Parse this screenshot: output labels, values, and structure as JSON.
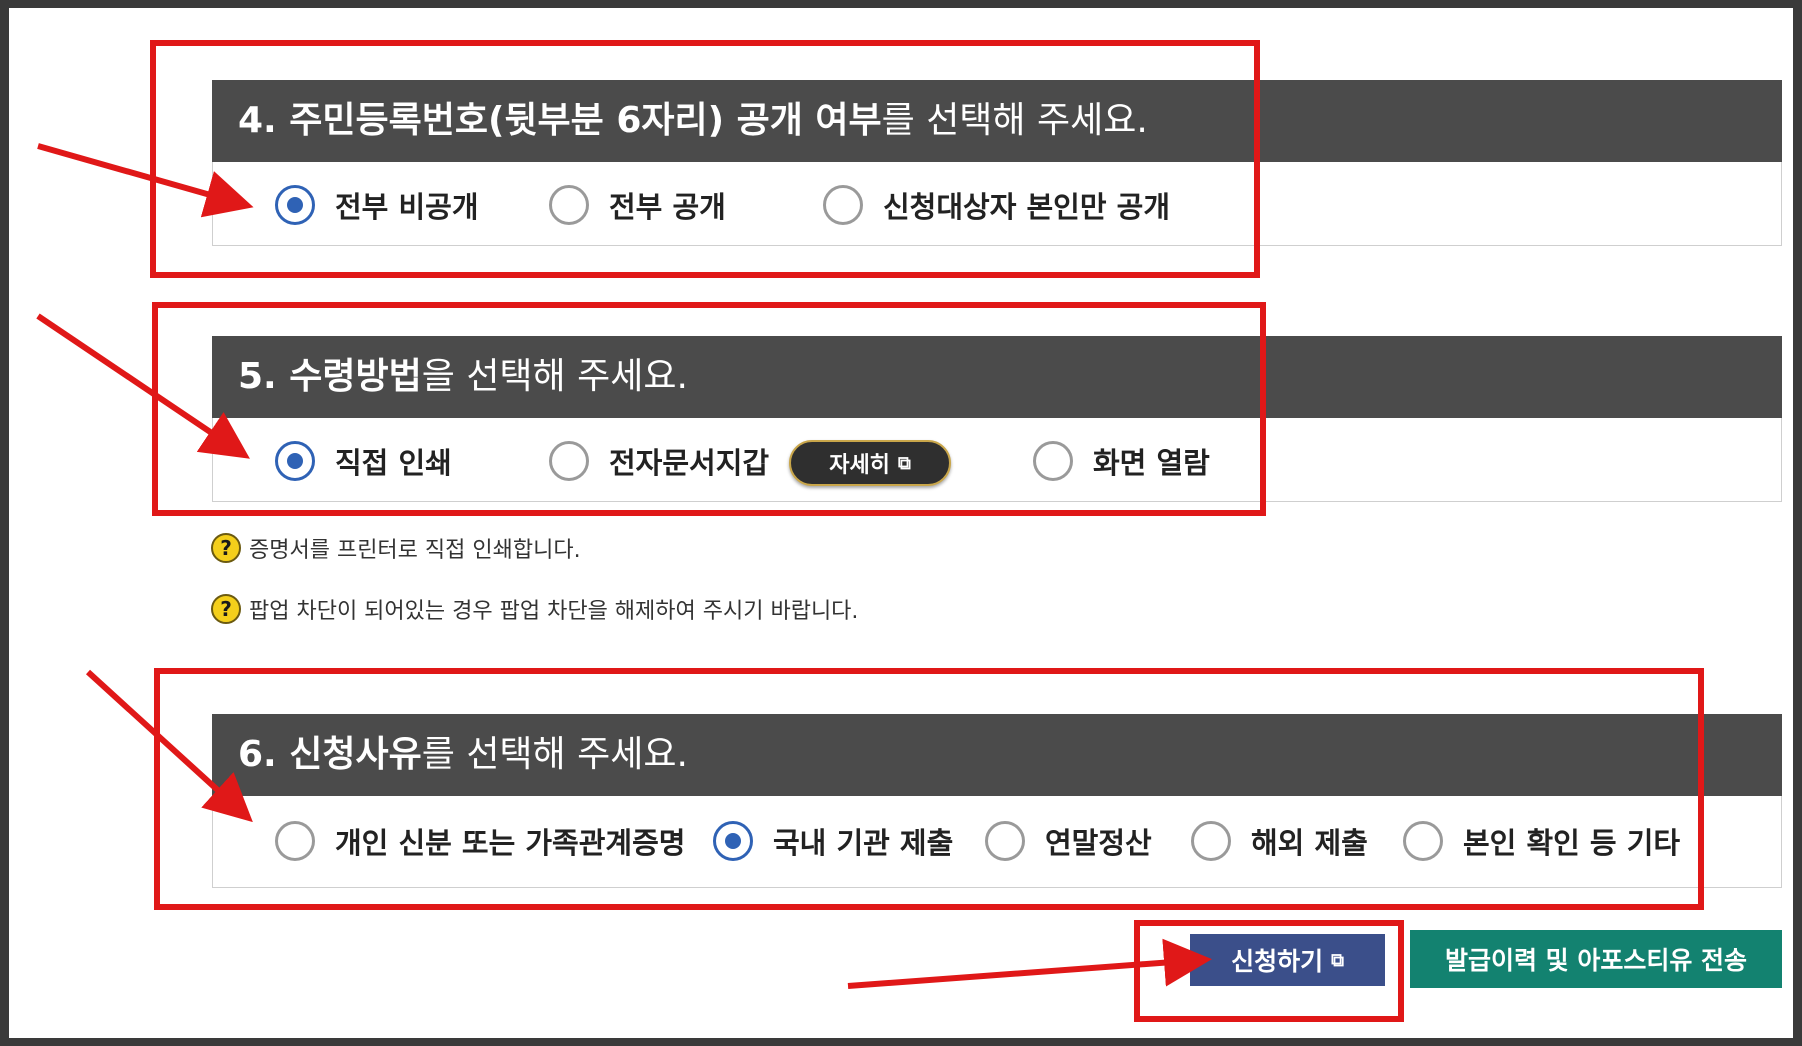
{
  "section4": {
    "title_bold": "4. 주민등록번호(뒷부분 6자리) 공개 여부",
    "title_rest": "를 선택해 주세요.",
    "options": [
      {
        "label": "전부 비공개",
        "selected": true
      },
      {
        "label": "전부 공개",
        "selected": false
      },
      {
        "label": "신청대상자 본인만 공개",
        "selected": false
      }
    ]
  },
  "section5": {
    "title_bold": "5. 수령방법",
    "title_rest": "을 선택해 주세요.",
    "options": [
      {
        "label": "직접 인쇄",
        "selected": true
      },
      {
        "label": "전자문서지갑",
        "selected": false
      },
      {
        "label": "화면 열람",
        "selected": false
      }
    ],
    "detail_button": "자세히",
    "hints": [
      "증명서를 프린터로 직접 인쇄합니다.",
      "팝업 차단이 되어있는 경우 팝업 차단을 해제하여 주시기 바랍니다."
    ]
  },
  "section6": {
    "title_bold": "6. 신청사유",
    "title_rest": "를 선택해 주세요.",
    "options": [
      {
        "label": "개인 신분 또는 가족관계증명",
        "selected": false
      },
      {
        "label": "국내 기관 제출",
        "selected": true
      },
      {
        "label": "연말정산",
        "selected": false
      },
      {
        "label": "해외 제출",
        "selected": false
      },
      {
        "label": "본인 확인 등 기타",
        "selected": false
      }
    ]
  },
  "buttons": {
    "apply": "신청하기",
    "send": "발급이력 및 아포스티유 전송"
  },
  "icons": {
    "hint": "question-icon",
    "external": "external-link-icon"
  },
  "colors": {
    "header_bg": "#4b4b4b",
    "radio_selected": "#2f62b5",
    "apply_bg": "#3b4f8a",
    "send_bg": "#138270",
    "annotation_red": "#e01818",
    "hint_icon": "#f4cf1b"
  }
}
